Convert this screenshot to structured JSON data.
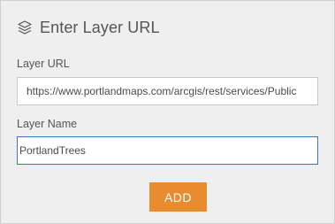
{
  "dialog": {
    "title": "Enter Layer URL",
    "title_icon": "layers-icon"
  },
  "fields": {
    "url": {
      "label": "Layer URL",
      "value": "https://www.portlandmaps.com/arcgis/rest/services/Public"
    },
    "name": {
      "label": "Layer Name",
      "value": "PortlandTrees"
    }
  },
  "actions": {
    "add_label": "ADD"
  },
  "colors": {
    "accent": "#e98c2f",
    "focus_border": "#3f74b5",
    "panel_bg": "#efefef"
  }
}
